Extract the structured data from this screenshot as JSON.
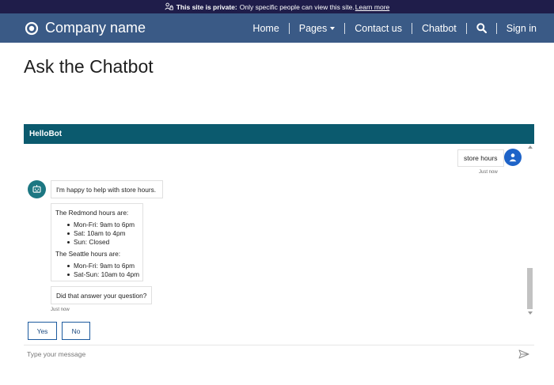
{
  "banner": {
    "strong": "This site is private:",
    "text": "Only specific people can view this site.",
    "link": "Learn more",
    "icon": "private-site-icon"
  },
  "nav": {
    "brand": "Company name",
    "logo_icon": "company-logo-icon",
    "links": [
      "Home",
      "Pages",
      "Contact us",
      "Chatbot",
      "Sign in"
    ],
    "search_icon": "search-icon"
  },
  "page": {
    "title": "Ask the Chatbot"
  },
  "chat": {
    "header": "HelloBot",
    "user_message": "store hours",
    "user_time": "Just now",
    "bot_intro": "I'm happy to help with store hours.",
    "redmond_heading": "The Redmond hours are:",
    "redmond_hours": [
      "Mon-Fri: 9am to 6pm",
      "Sat: 10am to 4pm",
      "Sun: Closed"
    ],
    "seattle_heading": "The Seattle hours are:",
    "seattle_hours": [
      "Mon-Fri: 9am to 6pm",
      "Sat-Sun: 10am to 4pm"
    ],
    "bot_question": "Did that answer your question?",
    "bot_time": "Just now",
    "actions": {
      "yes": "Yes",
      "no": "No"
    },
    "input_placeholder": "Type your message",
    "send_icon": "send-icon"
  },
  "colors": {
    "banner_bg": "#1f1d4a",
    "nav_bg": "#3a5a86",
    "bot_header_bg": "#0b5a6e",
    "user_avatar": "#1e63c8",
    "bot_avatar": "#1c7782",
    "action_border": "#1c5a9e"
  }
}
